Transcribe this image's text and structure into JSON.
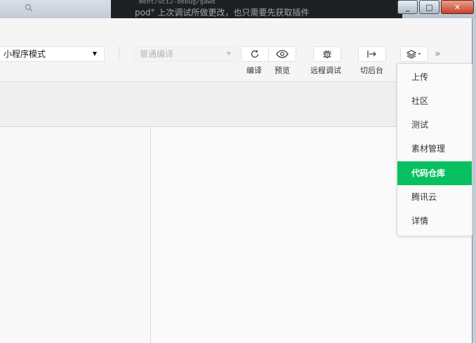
{
  "window": {
    "controls": {
      "minimize": "_",
      "maximize": "□",
      "close": "✕"
    }
  },
  "background_text": {
    "line1": "ment/uci2-debug/gawd",
    "line2": "pod° 上次调试所做更改，也只需要先获取插件"
  },
  "toolbar": {
    "mode_select": {
      "value": "小程序模式"
    },
    "compile_select": {
      "placeholder": "普通编译"
    },
    "buttons": [
      {
        "id": "compile",
        "label": "编译",
        "icon": "refresh-icon"
      },
      {
        "id": "preview",
        "label": "预览",
        "icon": "eye-icon"
      },
      {
        "id": "remote-debug",
        "label": "远程调试",
        "icon": "bug-icon"
      },
      {
        "id": "background",
        "label": "切后台",
        "icon": "switch-background-icon"
      },
      {
        "id": "more",
        "label": "",
        "icon": "layers-icon"
      }
    ],
    "overflow": "»"
  },
  "dropdown": {
    "items": [
      {
        "label": "上传",
        "active": false
      },
      {
        "label": "社区",
        "active": false
      },
      {
        "label": "测试",
        "active": false
      },
      {
        "label": "素材管理",
        "active": false
      },
      {
        "label": "代码仓库",
        "active": true
      },
      {
        "label": "腾讯云",
        "active": false
      },
      {
        "label": "详情",
        "active": false
      }
    ]
  },
  "colors": {
    "accent": "#07c160",
    "toolbar_bg": "#f5f5f5"
  }
}
